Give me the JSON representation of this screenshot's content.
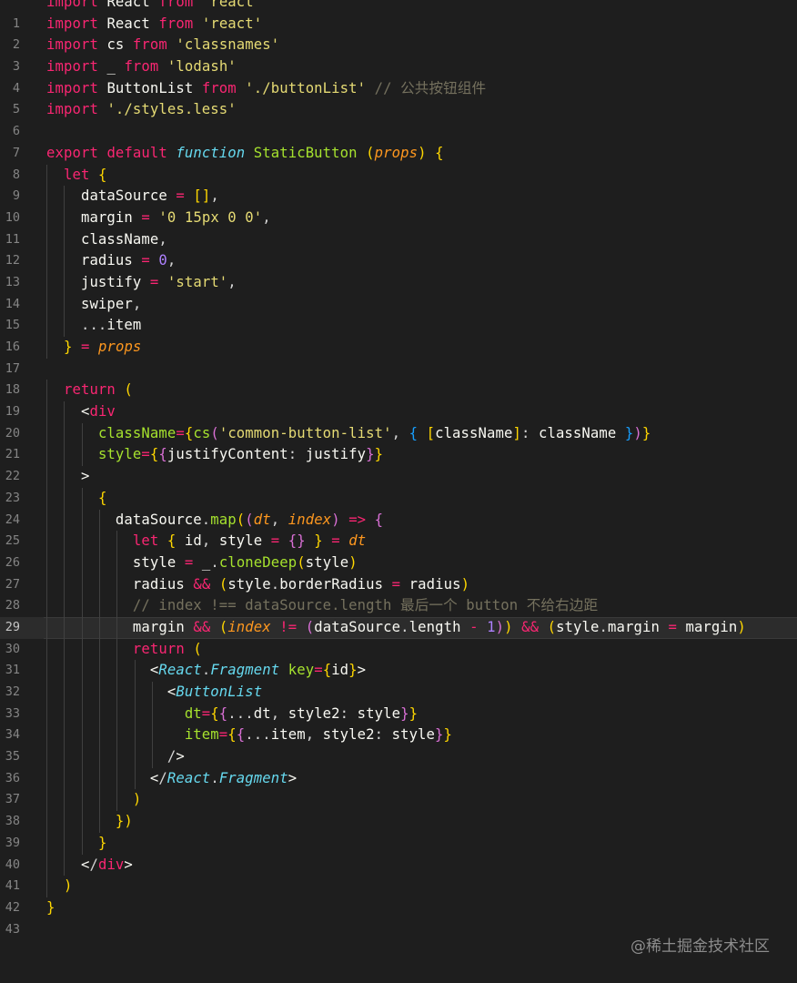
{
  "editor": {
    "language": "javascript-react",
    "theme": "dark",
    "active_line": 29,
    "lines": [
      {
        "n": "",
        "text": "import React from 'react'"
      },
      {
        "n": "1",
        "text": "import React from 'react'"
      },
      {
        "n": "2",
        "text": "import cs from 'classnames'"
      },
      {
        "n": "3",
        "text": "import _ from 'lodash'"
      },
      {
        "n": "4",
        "text": "import ButtonList from './buttonList' // 公共按钮组件"
      },
      {
        "n": "5",
        "text": "import './styles.less'"
      },
      {
        "n": "6",
        "text": ""
      },
      {
        "n": "7",
        "text": "export default function StaticButton (props) {"
      },
      {
        "n": "8",
        "text": "  let {"
      },
      {
        "n": "9",
        "text": "    dataSource = [],"
      },
      {
        "n": "10",
        "text": "    margin = '0 15px 0 0',"
      },
      {
        "n": "11",
        "text": "    className,"
      },
      {
        "n": "12",
        "text": "    radius = 0,"
      },
      {
        "n": "13",
        "text": "    justify = 'start',"
      },
      {
        "n": "14",
        "text": "    swiper,"
      },
      {
        "n": "15",
        "text": "    ...item"
      },
      {
        "n": "16",
        "text": "  } = props"
      },
      {
        "n": "17",
        "text": ""
      },
      {
        "n": "18",
        "text": "  return ("
      },
      {
        "n": "19",
        "text": "    <div"
      },
      {
        "n": "20",
        "text": "      className={cs('common-button-list', { [className]: className })}"
      },
      {
        "n": "21",
        "text": "      style={{justifyContent: justify}}"
      },
      {
        "n": "22",
        "text": "    >"
      },
      {
        "n": "23",
        "text": "      {"
      },
      {
        "n": "24",
        "text": "        dataSource.map((dt, index) => {"
      },
      {
        "n": "25",
        "text": "          let { id, style = {} } = dt"
      },
      {
        "n": "26",
        "text": "          style = _.cloneDeep(style)"
      },
      {
        "n": "27",
        "text": "          radius && (style.borderRadius = radius)"
      },
      {
        "n": "28",
        "text": "          // index !== dataSource.length 最后一个 button 不给右边距"
      },
      {
        "n": "29",
        "text": "          margin && (index != (dataSource.length - 1)) && (style.margin = margin)"
      },
      {
        "n": "30",
        "text": "          return ("
      },
      {
        "n": "31",
        "text": "            <React.Fragment key={id}>"
      },
      {
        "n": "32",
        "text": "              <ButtonList"
      },
      {
        "n": "33",
        "text": "                dt={{...dt, style2: style}}"
      },
      {
        "n": "34",
        "text": "                item={{...item, style2: style}}"
      },
      {
        "n": "35",
        "text": "              />"
      },
      {
        "n": "36",
        "text": "            </React.Fragment>"
      },
      {
        "n": "37",
        "text": "          )"
      },
      {
        "n": "38",
        "text": "        })"
      },
      {
        "n": "39",
        "text": "      }"
      },
      {
        "n": "40",
        "text": "    </div>"
      },
      {
        "n": "41",
        "text": "  )"
      },
      {
        "n": "42",
        "text": "}"
      },
      {
        "n": "43",
        "text": ""
      }
    ]
  },
  "watermark": "@稀土掘金技术社区",
  "colors": {
    "background": "#1e1e1e",
    "keyword": "#f92672",
    "string": "#e6db74",
    "comment": "#75715e",
    "function": "#a6e22e",
    "italic_keyword": "#66d9ef",
    "parameter": "#fd971f",
    "number": "#ae81ff",
    "line_number": "#858585"
  }
}
